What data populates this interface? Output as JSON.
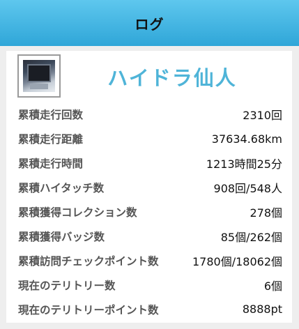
{
  "header": {
    "title": "ログ"
  },
  "profile": {
    "name": "ハイドラ仙人"
  },
  "stats": [
    {
      "label": "累積走行回数",
      "value": "2310回"
    },
    {
      "label": "累積走行距離",
      "value": "37634.68km"
    },
    {
      "label": "累積走行時間",
      "value": "1213時間25分"
    },
    {
      "label": "累積ハイタッチ数",
      "value": "908回/548人"
    },
    {
      "label": "累積獲得コレクション数",
      "value": "278個"
    },
    {
      "label": "累積獲得バッジ数",
      "value": "85個/262個"
    },
    {
      "label": "累積訪問チェックポイント数",
      "value": "1780個/18062個"
    },
    {
      "label": "現在のテリトリー数",
      "value": "6個"
    },
    {
      "label": "現在のテリトリーポイント数",
      "value": "8888pt"
    }
  ]
}
